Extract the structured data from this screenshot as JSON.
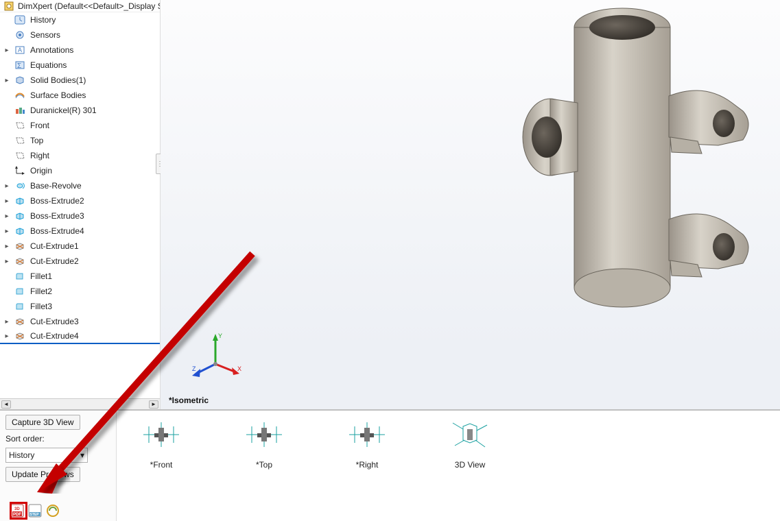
{
  "tree": {
    "title": "DimXpert  (Default<<Default>_Display S",
    "items": [
      {
        "caret": "",
        "icon": "history",
        "label": "History",
        "interactable": true
      },
      {
        "caret": "",
        "icon": "sensors",
        "label": "Sensors",
        "interactable": true
      },
      {
        "caret": "▸",
        "icon": "annotations",
        "label": "Annotations",
        "interactable": true
      },
      {
        "caret": "",
        "icon": "equations",
        "label": "Equations",
        "interactable": true
      },
      {
        "caret": "▸",
        "icon": "solidbodies",
        "label": "Solid Bodies(1)",
        "interactable": true
      },
      {
        "caret": "",
        "icon": "surfacebodies",
        "label": "Surface Bodies",
        "interactable": true
      },
      {
        "caret": "",
        "icon": "material",
        "label": "Duranickel(R) 301",
        "interactable": true
      },
      {
        "caret": "",
        "icon": "plane",
        "label": "Front",
        "interactable": true
      },
      {
        "caret": "",
        "icon": "plane",
        "label": "Top",
        "interactable": true
      },
      {
        "caret": "",
        "icon": "plane",
        "label": "Right",
        "interactable": true
      },
      {
        "caret": "",
        "icon": "origin",
        "label": "Origin",
        "interactable": true
      },
      {
        "caret": "▸",
        "icon": "revolve",
        "label": "Base-Revolve",
        "interactable": true
      },
      {
        "caret": "▸",
        "icon": "extrude",
        "label": "Boss-Extrude2",
        "interactable": true
      },
      {
        "caret": "▸",
        "icon": "extrude",
        "label": "Boss-Extrude3",
        "interactable": true
      },
      {
        "caret": "▸",
        "icon": "extrude",
        "label": "Boss-Extrude4",
        "interactable": true
      },
      {
        "caret": "▸",
        "icon": "cut",
        "label": "Cut-Extrude1",
        "interactable": true
      },
      {
        "caret": "▸",
        "icon": "cut",
        "label": "Cut-Extrude2",
        "interactable": true
      },
      {
        "caret": "",
        "icon": "fillet",
        "label": "Fillet1",
        "interactable": true
      },
      {
        "caret": "",
        "icon": "fillet",
        "label": "Fillet2",
        "interactable": true
      },
      {
        "caret": "",
        "icon": "fillet",
        "label": "Fillet3",
        "interactable": true
      },
      {
        "caret": "▸",
        "icon": "cut",
        "label": "Cut-Extrude3",
        "interactable": true
      },
      {
        "caret": "▸",
        "icon": "cut",
        "label": "Cut-Extrude4",
        "interactable": true
      }
    ]
  },
  "viewport": {
    "view_label": "*Isometric",
    "axes": {
      "x": "X",
      "y": "Y",
      "z": "Z"
    }
  },
  "bottom_panel": {
    "capture_button": "Capture 3D View",
    "sort_label": "Sort order:",
    "sort_value": "History",
    "update_button": "Update Previews",
    "views": [
      {
        "name": "*Front"
      },
      {
        "name": "*Top"
      },
      {
        "name": "*Right"
      },
      {
        "name": "3D View"
      }
    ]
  },
  "footer_icons": {
    "pdf": "3D PDF",
    "step": "STEP",
    "edrawings": "eDrawings"
  },
  "icon_colors": {
    "tree_box": "#4a7fc1",
    "tree_box_fill": "#dbe8f7",
    "revolve": "#1aa0d8",
    "fillet": "#3fa8d6",
    "origin": "#2b2b2b"
  }
}
